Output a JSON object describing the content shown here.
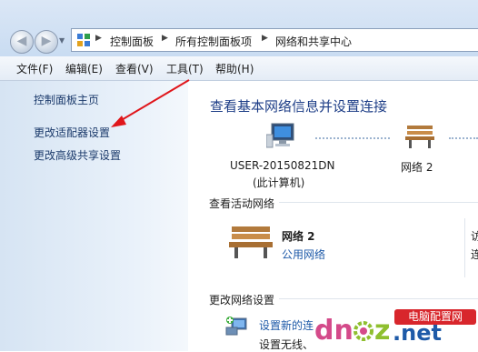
{
  "breadcrumb": {
    "items": [
      "控制面板",
      "所有控制面板项",
      "网络和共享中心"
    ]
  },
  "menu": [
    "文件(F)",
    "编辑(E)",
    "查看(V)",
    "工具(T)",
    "帮助(H)"
  ],
  "left_pane": {
    "home": "控制面板主页",
    "adapter_settings": "更改适配器设置",
    "advanced_sharing": "更改高级共享设置"
  },
  "main": {
    "heading": "查看基本网络信息并设置连接",
    "computer_name": "USER-20150821DN",
    "computer_sub": "(此计算机)",
    "network_map_name": "网络  2",
    "active_header": "查看活动网络",
    "active_network": "网络  2",
    "network_type": "公用网络",
    "right_cut": "访",
    "right_cut2": "连",
    "change_header": "更改网络设置",
    "setup_link": "设置新的连",
    "setup_desc": "设置无线、"
  },
  "watermark": {
    "text_left": "dn",
    "text_z": "z",
    "text_net": ".net",
    "badge": "电脑配置网"
  },
  "colors": {
    "accent_link": "#1e5aa8",
    "heading": "#1e3e87",
    "arrow": "#e0161b"
  }
}
